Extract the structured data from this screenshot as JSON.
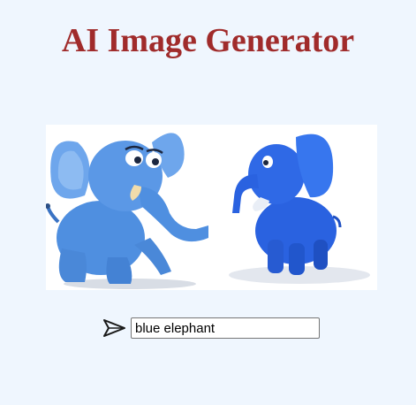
{
  "header": {
    "title": "AI Image Generator",
    "title_color": "#a02b2b"
  },
  "gallery": {
    "images": [
      {
        "icon": "cartoon-elephant-image",
        "fill": "#4f8fe0"
      },
      {
        "icon": "cartoon-elephant-image",
        "fill": "#2a62e0"
      }
    ]
  },
  "prompt": {
    "value": "blue elephant",
    "send_icon": "send-icon"
  },
  "colors": {
    "background": "#eff6fe"
  }
}
